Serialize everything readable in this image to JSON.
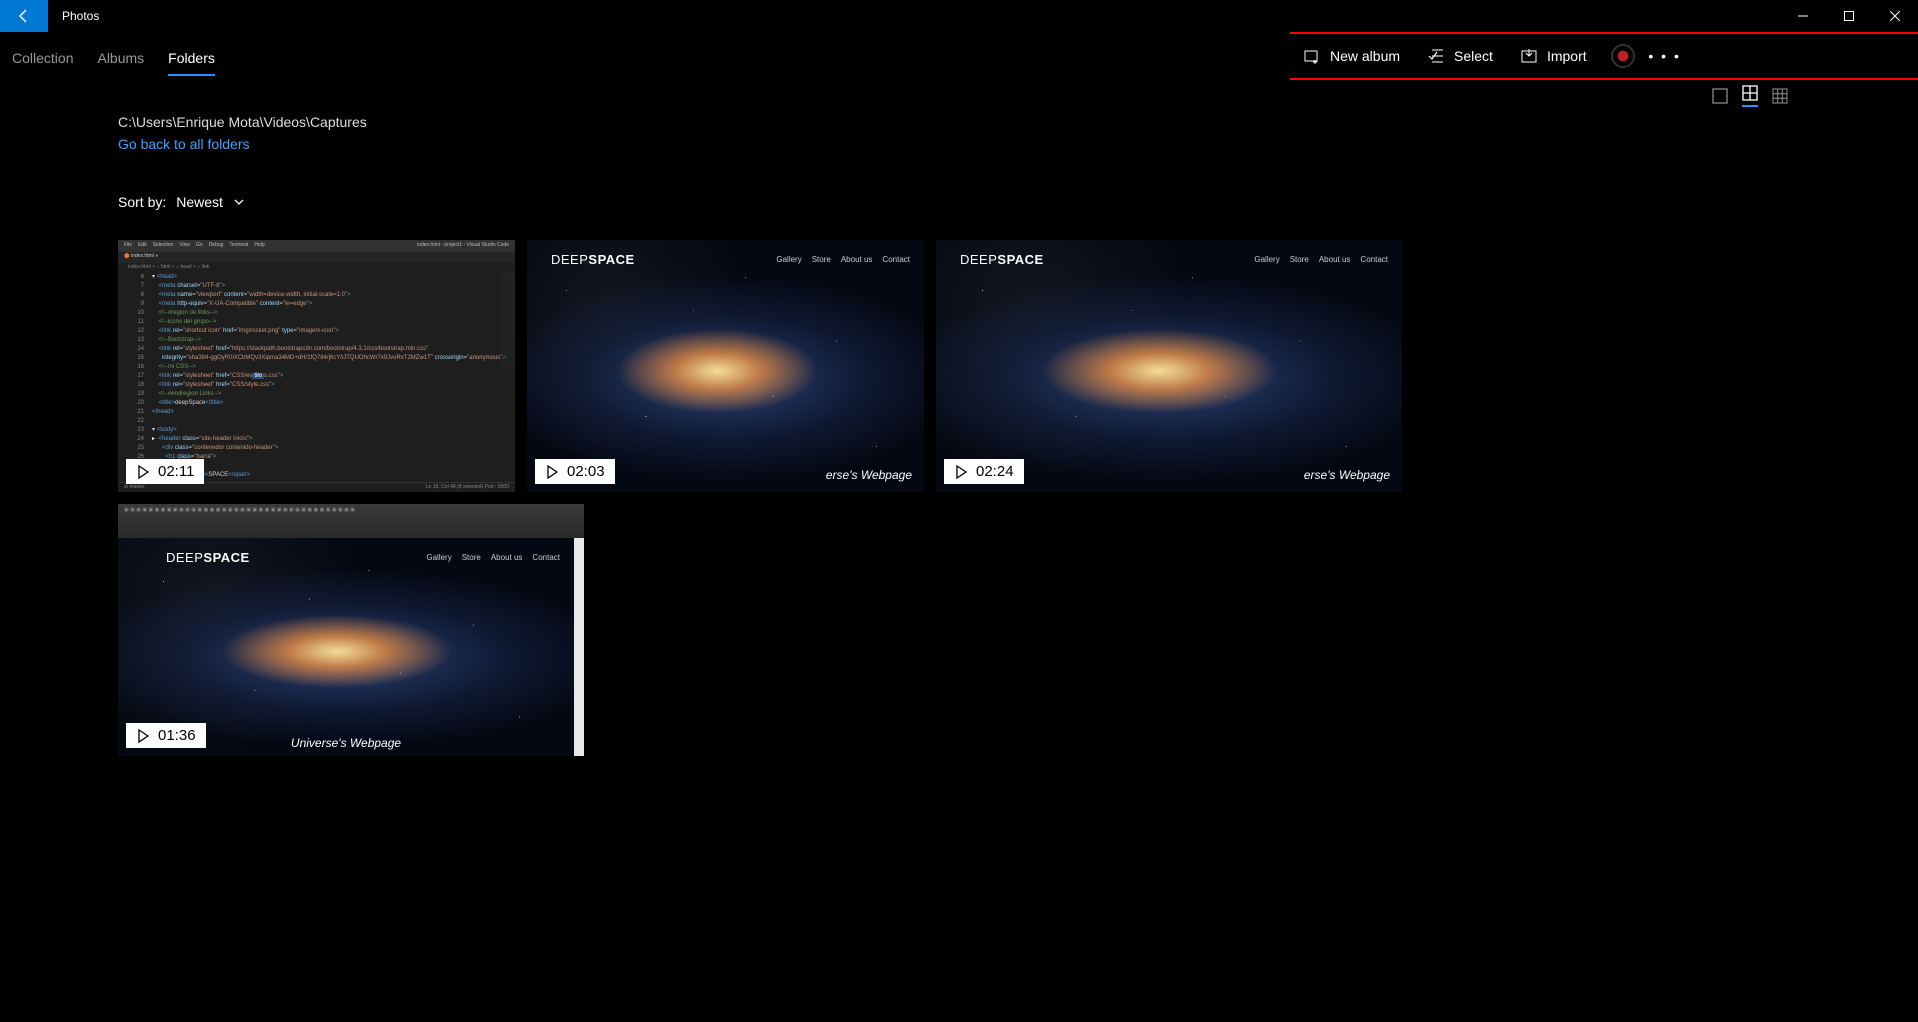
{
  "app": {
    "title": "Photos"
  },
  "tabs": {
    "collection": "Collection",
    "albums": "Albums",
    "folders": "Folders"
  },
  "commands": {
    "new_album": "New album",
    "select": "Select",
    "import": "Import"
  },
  "path": "C:\\Users\\Enrique Mota\\Videos\\Captures",
  "back_link": "Go back to all folders",
  "sort": {
    "label": "Sort by:",
    "value": "Newest"
  },
  "tiles": [
    {
      "duration": "02:11"
    },
    {
      "duration": "02:03"
    },
    {
      "duration": "02:24"
    },
    {
      "duration": "01:36"
    }
  ],
  "deepspace": {
    "logo_thin": "DEEP",
    "logo_bold": "SPACE",
    "nav": [
      "Gallery",
      "Store",
      "About us",
      "Contact"
    ],
    "tagline_partial": "erse's Webpage",
    "tagline_full": "Universe's Webpage"
  },
  "vscode": {
    "menu": [
      "File",
      "Edit",
      "Selection",
      "View",
      "Go",
      "Debug",
      "Terminal",
      "Help"
    ],
    "title_right": "index.html - project1 - Visual Studio Code",
    "tab": "index.html",
    "crumb": "index.html > ⌂ html > ⌂ head > ⌂ link",
    "status_left": "⊘ master",
    "status_right": "Ln 15, Col 48 (8 selected)   Port : 5500"
  }
}
